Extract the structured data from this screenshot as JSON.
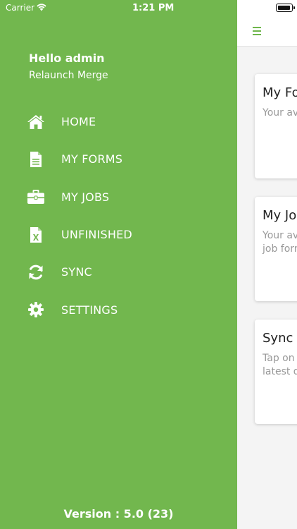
{
  "status_bar": {
    "carrier": "Carrier",
    "time": "1:21 PM"
  },
  "drawer": {
    "greeting": "Hello admin",
    "subtitle": "Relaunch Merge",
    "items": [
      {
        "label": "HOME",
        "icon": "home-icon"
      },
      {
        "label": "MY FORMS",
        "icon": "document-icon"
      },
      {
        "label": "MY JOBS",
        "icon": "briefcase-icon"
      },
      {
        "label": "UNFINISHED",
        "icon": "excel-file-icon"
      },
      {
        "label": "SYNC",
        "icon": "sync-icon"
      },
      {
        "label": "SETTINGS",
        "icon": "gear-icon"
      }
    ],
    "version": "Version : 5.0 (23)"
  },
  "main": {
    "cards": [
      {
        "title": "My Fo",
        "desc_lines": [
          "Your av"
        ]
      },
      {
        "title": "My Jol",
        "desc_lines": [
          "Your av",
          "job forn"
        ]
      },
      {
        "title": "Sync",
        "desc_lines": [
          "Tap on",
          "latest d"
        ]
      }
    ]
  },
  "colors": {
    "drawer_bg": "#72b74e",
    "accent": "#6eb64b"
  }
}
